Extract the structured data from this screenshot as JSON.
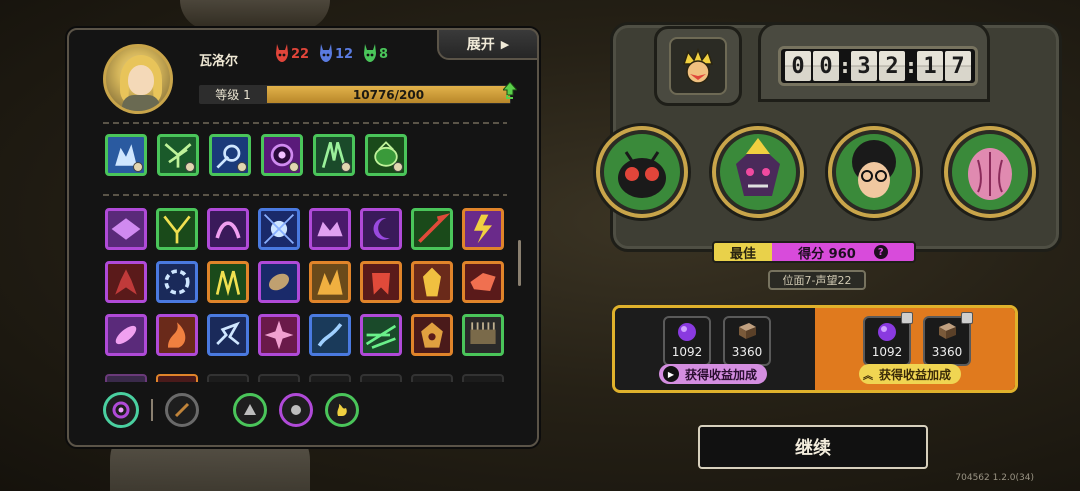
{
  "character": {
    "name": "瓦洛尔",
    "expand_label": "展开",
    "stats": [
      {
        "icon": "red-demon-icon",
        "color": "#e0453a",
        "value": "22"
      },
      {
        "icon": "blue-demon-icon",
        "color": "#5a7be0",
        "value": "12"
      },
      {
        "icon": "green-demon-icon",
        "color": "#4ac55a",
        "value": "8"
      }
    ],
    "level_label": "等级 1",
    "exp_text": "10776/200",
    "level_progress": 1.0
  },
  "timer": {
    "h1": "0",
    "h2": "0",
    "m1": "3",
    "m2": "2",
    "s1": "1",
    "s2": "7"
  },
  "score": {
    "best_label": "最佳",
    "score_text": "得分 960",
    "help": "?",
    "stage": "位面7-声望22"
  },
  "rewards": {
    "left": {
      "items": [
        {
          "icon": "purple-orb-icon",
          "count": "1092"
        },
        {
          "icon": "brick-icon",
          "count": "3360"
        }
      ],
      "button": "获得收益加成"
    },
    "right": {
      "items": [
        {
          "icon": "purple-orb-icon",
          "count": "1092"
        },
        {
          "icon": "brick-icon",
          "count": "3360"
        }
      ],
      "button": "获得收益加成"
    }
  },
  "continue_label": "继续",
  "version": "704562 1.2.0(34)",
  "colors": {
    "gold": "#c9a54a",
    "purple": "#d84bdb",
    "yellow": "#e9d14a",
    "orange": "#e07a1e"
  }
}
